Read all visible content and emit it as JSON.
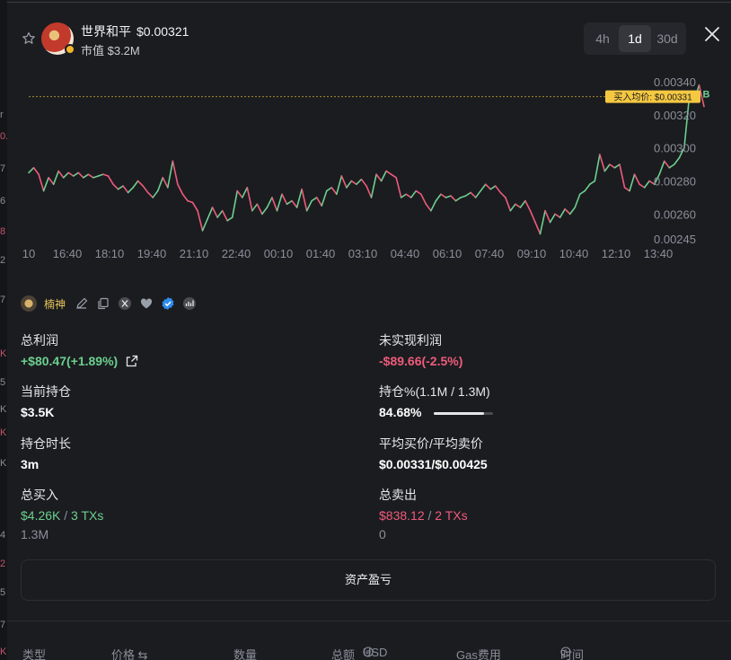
{
  "edge_fragments": [
    "r",
    "0.",
    "7",
    "6",
    "8",
    "2",
    "7",
    "K",
    "5",
    "K",
    "K",
    "K",
    "4",
    "2",
    "5",
    "7",
    "K"
  ],
  "token": {
    "name": "世界和平",
    "price": "$0.00321",
    "market_cap": "市值 $3.2M"
  },
  "timeframes": [
    {
      "label": "4h",
      "active": false
    },
    {
      "label": "1d",
      "active": true
    },
    {
      "label": "30d",
      "active": false
    }
  ],
  "chart_data": {
    "type": "line",
    "x_labels": [
      "10",
      "16:40",
      "18:10",
      "19:40",
      "21:10",
      "22:40",
      "00:10",
      "01:40",
      "03:10",
      "04:40",
      "06:10",
      "07:40",
      "09:10",
      "10:40",
      "12:10",
      "13:40"
    ],
    "y_ticks": [
      "0.00340",
      "0.00320",
      "0.00300",
      "0.00280",
      "0.00260",
      "0.00245"
    ],
    "ylim": [
      0.00245,
      0.0034
    ],
    "avg_buy_label": "买入均价: $0.00331",
    "avg_buy_value": 0.00331,
    "marker_label": "B",
    "up_color": "#6bd08e",
    "down_color": "#ef5b7b",
    "values": [
      0.00285,
      0.00288,
      0.00284,
      0.00274,
      0.00282,
      0.00278,
      0.00286,
      0.00282,
      0.00285,
      0.00283,
      0.00285,
      0.00282,
      0.00284,
      0.00282,
      0.00283,
      0.00284,
      0.00283,
      0.00278,
      0.00275,
      0.00277,
      0.00273,
      0.00276,
      0.0028,
      0.00277,
      0.00273,
      0.0027,
      0.00274,
      0.00282,
      0.00276,
      0.00292,
      0.00278,
      0.00272,
      0.00268,
      0.00267,
      0.00262,
      0.0025,
      0.00257,
      0.00264,
      0.00258,
      0.00262,
      0.00256,
      0.00258,
      0.00274,
      0.0027,
      0.00276,
      0.00262,
      0.00266,
      0.0026,
      0.00264,
      0.0027,
      0.00262,
      0.00272,
      0.00266,
      0.00268,
      0.00264,
      0.00275,
      0.00262,
      0.00268,
      0.0027,
      0.00265,
      0.00274,
      0.00276,
      0.00272,
      0.00283,
      0.00276,
      0.0028,
      0.00278,
      0.00281,
      0.00277,
      0.0027,
      0.00284,
      0.0028,
      0.00286,
      0.00284,
      0.00282,
      0.0027,
      0.00272,
      0.0027,
      0.00274,
      0.00272,
      0.00266,
      0.00262,
      0.00268,
      0.00272,
      0.0027,
      0.00271,
      0.00268,
      0.0027,
      0.00271,
      0.00273,
      0.0027,
      0.00274,
      0.00278,
      0.00275,
      0.00277,
      0.00273,
      0.0027,
      0.00262,
      0.00266,
      0.00264,
      0.00268,
      0.00262,
      0.00255,
      0.00248,
      0.00262,
      0.00255,
      0.0026,
      0.00258,
      0.00263,
      0.0026,
      0.00264,
      0.00272,
      0.00274,
      0.00278,
      0.0028,
      0.00296,
      0.00286,
      0.0029,
      0.00288,
      0.0029,
      0.00276,
      0.00274,
      0.00284,
      0.00278,
      0.00276,
      0.0028,
      0.00278,
      0.00284,
      0.00292,
      0.00288,
      0.0029,
      0.00294,
      0.003,
      0.0033,
      0.00328,
      0.00338,
      0.00325
    ]
  },
  "wallet": {
    "name": "楠神"
  },
  "stats": {
    "total_pnl": {
      "label": "总利润",
      "value": "+$80.47(+1.89%)"
    },
    "unrealized": {
      "label": "未实现利润",
      "value": "-$89.66(-2.5%)"
    },
    "holding": {
      "label": "当前持仓",
      "value": "$3.5K"
    },
    "holding_pct": {
      "label": "持仓%(1.1M / 1.3M)",
      "value": "84.68%",
      "fraction": 0.8468
    },
    "duration": {
      "label": "持仓时长",
      "value": "3m"
    },
    "avg_prices": {
      "label": "平均买价/平均卖价",
      "value": "$0.00331/$0.00425"
    },
    "total_buy": {
      "label": "总买入",
      "amount": "$4.26K",
      "txs": "3 TXs",
      "qty": "1.3M"
    },
    "total_sell": {
      "label": "总卖出",
      "amount": "$838.12",
      "txs": "2 TXs",
      "qty": "0"
    }
  },
  "pnl_button": "资产盈亏",
  "table_headers": [
    "类型",
    "价格 ⇆",
    "数量",
    "总额",
    "USD",
    "Gas费用",
    "时间"
  ]
}
